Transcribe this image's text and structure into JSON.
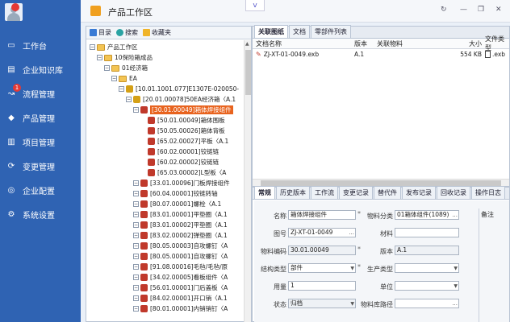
{
  "sidebar": {
    "items": [
      {
        "label": "工作台",
        "icon": "monitor-icon",
        "badge": ""
      },
      {
        "label": "企业知识库",
        "icon": "book-icon",
        "badge": ""
      },
      {
        "label": "流程管理",
        "icon": "flow-icon",
        "badge": "1"
      },
      {
        "label": "产品管理",
        "icon": "cube-icon",
        "badge": ""
      },
      {
        "label": "项目管理",
        "icon": "bar-chart-icon",
        "badge": ""
      },
      {
        "label": "变更管理",
        "icon": "refresh-icon",
        "badge": ""
      },
      {
        "label": "企业配置",
        "icon": "globe-icon",
        "badge": ""
      },
      {
        "label": "系统设置",
        "icon": "gear-icon",
        "badge": ""
      }
    ]
  },
  "titlebar": {
    "title": "产品工作区",
    "chevron": "v"
  },
  "left_toolbar": {
    "tabs": [
      "目录",
      "搜索",
      "收藏夹"
    ]
  },
  "tree": [
    {
      "text": "产品工作区",
      "level": 0,
      "type": "folder"
    },
    {
      "text": "10保险箱成品",
      "level": 1,
      "type": "folder"
    },
    {
      "text": "01经济箱",
      "level": 2,
      "type": "folder"
    },
    {
      "text": "EA",
      "level": 3,
      "type": "folder"
    },
    {
      "text": "[10.01.1001.077]E1307E-020050-",
      "level": 4,
      "type": "part"
    },
    {
      "text": "[20.01.00078]50EA经济箱〈A.1",
      "level": 5,
      "type": "part"
    },
    {
      "text": "[30.01.00049]箱体焊接组件",
      "level": 6,
      "type": "part",
      "selected": true
    },
    {
      "text": "[50.01.00049]箱体围板",
      "level": 7,
      "type": "part"
    },
    {
      "text": "[50.05.00026]箱体背板",
      "level": 7,
      "type": "part"
    },
    {
      "text": "[65.02.00027]平板〈A.1",
      "level": 7,
      "type": "part"
    },
    {
      "text": "[60.02.00001]铰链链",
      "level": 7,
      "type": "part"
    },
    {
      "text": "[60.02.00002]铰链链",
      "level": 7,
      "type": "part"
    },
    {
      "text": "[65.03.00002]L型板〈A",
      "level": 7,
      "type": "part"
    },
    {
      "text": "[33.01.00096]门板焊接组件",
      "level": 6,
      "type": "part"
    },
    {
      "text": "[60.04.00001]铰链转轴",
      "level": 6,
      "type": "part"
    },
    {
      "text": "[80.07.00001]螺栓〈A.1",
      "level": 6,
      "type": "part"
    },
    {
      "text": "[83.01.00001]平垫圈〈A.1",
      "level": 6,
      "type": "part"
    },
    {
      "text": "[83.01.00002]平垫圈〈A.1",
      "level": 6,
      "type": "part"
    },
    {
      "text": "[83.02.00002]弹垫圈〈A.1",
      "level": 6,
      "type": "part"
    },
    {
      "text": "[80.05.00003]自攻螺钉〈A",
      "level": 6,
      "type": "part"
    },
    {
      "text": "[80.05.00001]自攻螺钉〈A",
      "level": 6,
      "type": "part"
    },
    {
      "text": "[91.08.00016]毛毡/毛毡/原",
      "level": 6,
      "type": "part"
    },
    {
      "text": "[34.02.00005]看板组件〈A",
      "level": 6,
      "type": "part"
    },
    {
      "text": "[56.01.00001]门后盖板〈A",
      "level": 6,
      "type": "part"
    },
    {
      "text": "[84.02.00001]开口销〈A.1",
      "level": 6,
      "type": "part"
    },
    {
      "text": "[80.01.00001]内销销钉〈A",
      "level": 6,
      "type": "part"
    }
  ],
  "top_tabs": [
    "关联图纸",
    "文档",
    "零部件列表"
  ],
  "doc_grid": {
    "headers": [
      "文档名称",
      "版本",
      "关联物料",
      "大小",
      "文件类型"
    ],
    "rows": [
      {
        "name": "ZJ-XT-01-0049.exb",
        "version": "A.1",
        "material": "",
        "size": "554 KB",
        "filetype": ".exb"
      }
    ]
  },
  "bottom_tabs": [
    "常规",
    "历史版本",
    "工作流",
    "变更记录",
    "替代件",
    "发布记录",
    "回收记录",
    "操作日志"
  ],
  "form": {
    "name_label": "名称",
    "name_value": "箱体焊接组件",
    "category_label": "物料分类",
    "category_value": "01箱体组件(1089)",
    "drawing_label": "图号",
    "drawing_value": "ZJ-XT-01-0049",
    "material_label": "材料",
    "material_value": "",
    "code_label": "物料编码",
    "code_value": "30.01.00049",
    "version_label": "版本",
    "version_value": "A.1",
    "struct_label": "结构类型",
    "struct_value": "部件",
    "prod_label": "生产类型",
    "prod_value": "",
    "qty_label": "用量",
    "qty_value": "1",
    "unit_label": "单位",
    "unit_value": "",
    "status_label": "状态",
    "status_value": "归档",
    "lib_label": "物料库路径",
    "lib_value": "",
    "remark_label": "备注"
  }
}
